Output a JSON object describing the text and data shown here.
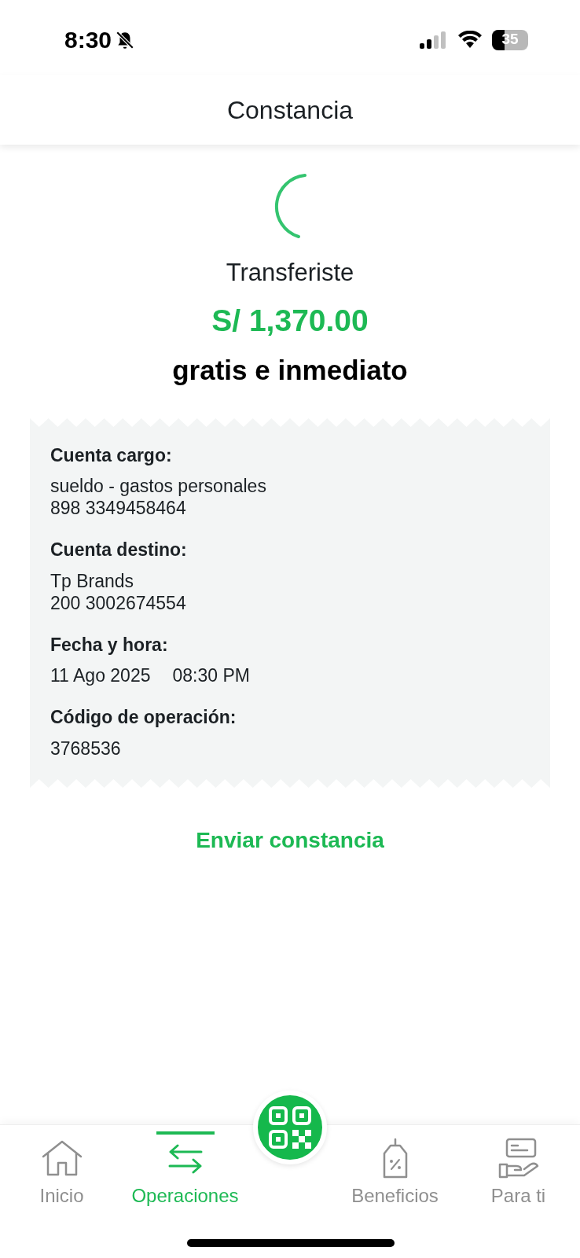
{
  "status_bar": {
    "time": "8:30",
    "battery": "35"
  },
  "header": {
    "title": "Constancia"
  },
  "result": {
    "title": "Transferiste",
    "amount": "S/ 1,370.00",
    "subtitle": "gratis e inmediato"
  },
  "receipt": {
    "fields": [
      {
        "label": "Cuenta cargo:",
        "lines": [
          [
            "sueldo - gastos personales"
          ],
          [
            "898 3349458464"
          ]
        ]
      },
      {
        "label": "Cuenta destino:",
        "lines": [
          [
            "Tp Brands"
          ],
          [
            "200 3002674554"
          ]
        ]
      },
      {
        "label": "Fecha y hora:",
        "lines": [
          [
            "11 Ago 2025",
            "08:30 PM"
          ]
        ]
      },
      {
        "label": "Código de operación:",
        "lines": [
          [
            "3768536"
          ]
        ]
      }
    ]
  },
  "send_link": "Enviar constancia",
  "bottom_nav": {
    "items": [
      {
        "kind": "home",
        "label": "Inicio",
        "selected": false
      },
      {
        "kind": "transfer",
        "label": "Operaciones",
        "selected": true
      },
      {
        "kind": "qr"
      },
      {
        "kind": "tag",
        "label": "Beneficios",
        "selected": false
      },
      {
        "kind": "card",
        "label": "Para ti",
        "selected": false
      }
    ]
  }
}
